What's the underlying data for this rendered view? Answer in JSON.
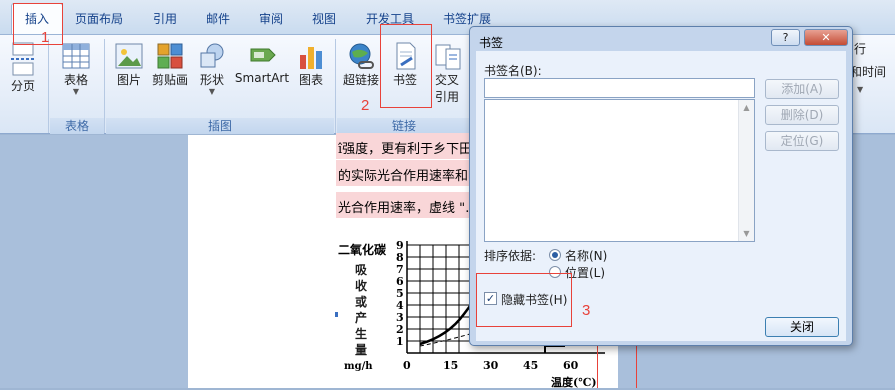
{
  "tabs": [
    "插入",
    "页面布局",
    "引用",
    "邮件",
    "审阅",
    "视图",
    "开发工具",
    "书签扩展"
  ],
  "ribbon": {
    "page_break": "分页",
    "table": "表格",
    "table_group": "表格",
    "picture": "图片",
    "clipart": "剪贴画",
    "shapes": "形状",
    "smartart": "SmartArt",
    "chart": "图表",
    "illustrations_group": "插图",
    "hyperlink": "超链接",
    "bookmark": "书签",
    "crossref_line1": "交叉",
    "crossref_line2": "引用",
    "links_group": "链接",
    "right_fragment_1": "行",
    "right_fragment_2": "和时间"
  },
  "document": {
    "line1": "î强度，更有利于乡下田",
    "line2": "的实际光合作用速率和呼",
    "line3": "光合作用速率，虚线 \"…",
    "graph_ylabel_top": "二氧化碳",
    "graph_ylabel_vertical": "吸收或产生量",
    "graph_unit": "mg/h",
    "graph_xlabel": "温度(℃)",
    "y_ticks": [
      "9",
      "8",
      "7",
      "6",
      "5",
      "4",
      "3",
      "2",
      "1"
    ],
    "x_ticks": [
      "0",
      "15",
      "30",
      "45",
      "60"
    ]
  },
  "dialog": {
    "title": "书签",
    "help": "?",
    "close": "✕",
    "name_label": "书签名(B):",
    "name_value": "",
    "add": "添加(A)",
    "delete": "删除(D)",
    "goto": "定位(G)",
    "sort_label": "排序依据:",
    "sort_name": "名称(N)",
    "sort_location": "位置(L)",
    "hide_bookmarks": "隐藏书签(H)",
    "close_button": "关闭"
  },
  "annotations": {
    "n1": "1",
    "n2": "2",
    "n3": "3",
    "color": "#e8423a"
  }
}
